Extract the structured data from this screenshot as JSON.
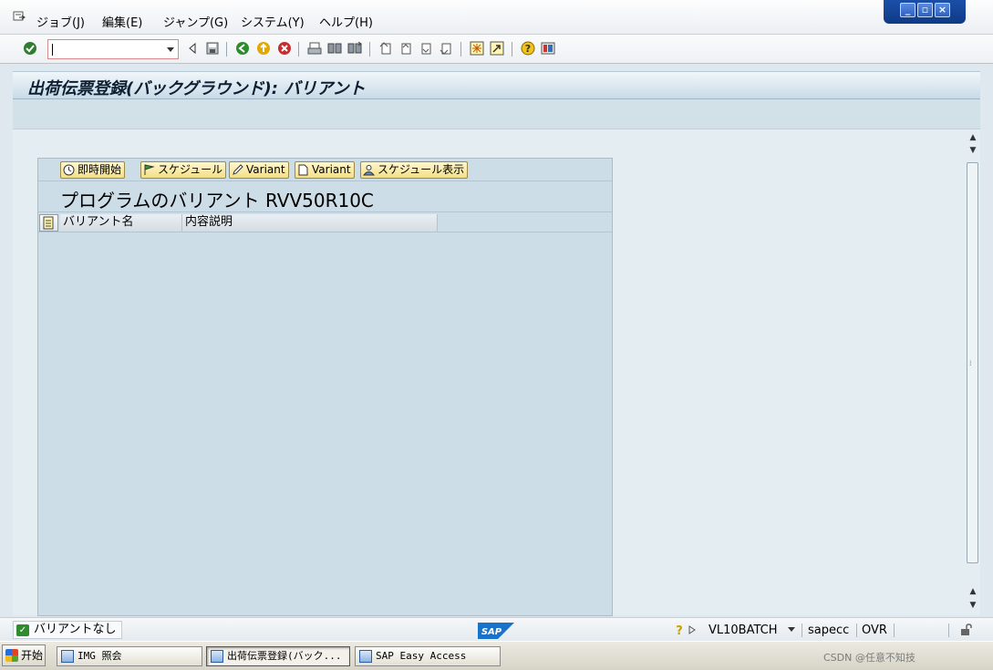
{
  "menu": {
    "items": [
      "ジョブ(J)",
      "編集(E)",
      "ジャンプ(G)",
      "システム(Y)",
      "ヘルプ(H)"
    ]
  },
  "toolbar": {
    "command_value": ""
  },
  "title": "出荷伝票登録(バックグラウンド): バリアント",
  "panel": {
    "buttons": [
      "即時開始",
      "スケジュール",
      "Variant",
      "Variant",
      "スケジュール表示"
    ],
    "heading": "プログラムのバリアント RVV50R10C",
    "columns": [
      "バリアント名",
      "内容説明"
    ]
  },
  "status": {
    "message": "バリアントなし",
    "logo": "SAP",
    "user": "VL10BATCH",
    "server": "sapecc",
    "mode": "OVR"
  },
  "taskbar": {
    "start_label": "开始",
    "tasks": [
      "IMG 照会",
      "出荷伝票登録(バック...",
      "SAP Easy Access"
    ],
    "tray_text": "CSDN @任意不知技"
  },
  "colors": {
    "title_gradient_bottom": "#c9dbe7",
    "panel_bg": "#ccdde8",
    "button_yellow": "#f3df87",
    "sap_blue": "#1a73c9"
  }
}
